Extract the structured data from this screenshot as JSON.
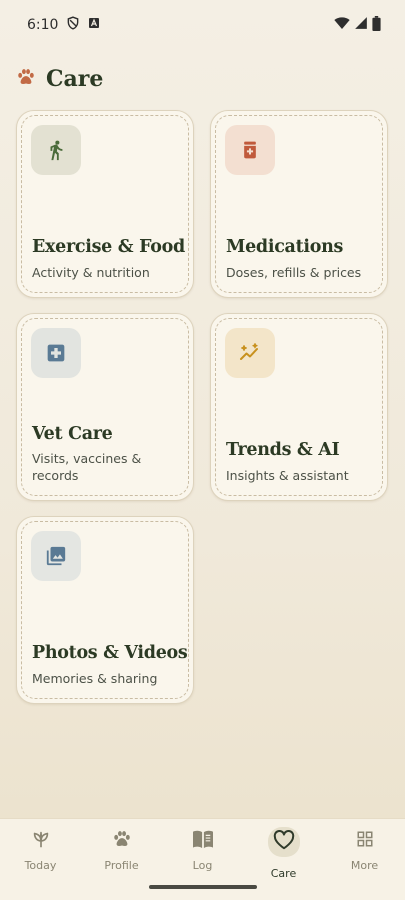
{
  "status_bar": {
    "time": "6:10"
  },
  "header": {
    "title": "Care",
    "icon": "paw-icon"
  },
  "cards": [
    {
      "title": "Exercise & Food",
      "subtitle": "Activity & nutrition",
      "icon": "walking-person-icon"
    },
    {
      "title": "Medications",
      "subtitle": "Doses, refills & prices",
      "icon": "medicine-bottle-icon"
    },
    {
      "title": "Vet Care",
      "subtitle": "Visits, vaccines & records",
      "icon": "medical-cross-icon"
    },
    {
      "title": "Trends & AI",
      "subtitle": "Insights & assistant",
      "icon": "sparkle-trend-icon"
    },
    {
      "title": "Photos & Videos",
      "subtitle": "Memories & sharing",
      "icon": "photo-library-icon"
    }
  ],
  "nav": {
    "items": [
      {
        "label": "Today",
        "icon": "sprout-icon"
      },
      {
        "label": "Profile",
        "icon": "paw-icon"
      },
      {
        "label": "Log",
        "icon": "book-icon"
      },
      {
        "label": "Care",
        "icon": "heart-icon",
        "active": true
      },
      {
        "label": "More",
        "icon": "grid-icon"
      }
    ]
  },
  "colors": {
    "exercise_icon_bg": "#e3e1d2",
    "exercise_icon": "#4a6b3a",
    "medications_icon_bg": "#f3dfd1",
    "medications_icon": "#c05a3c",
    "vet_icon_bg": "#e2e4e0",
    "vet_icon": "#5a7a94",
    "trends_icon_bg": "#f3e5c9",
    "trends_icon": "#c8911e",
    "photos_icon_bg": "#e4e6e2",
    "photos_icon": "#5a7a94",
    "accent_paw": "#c26a45"
  }
}
